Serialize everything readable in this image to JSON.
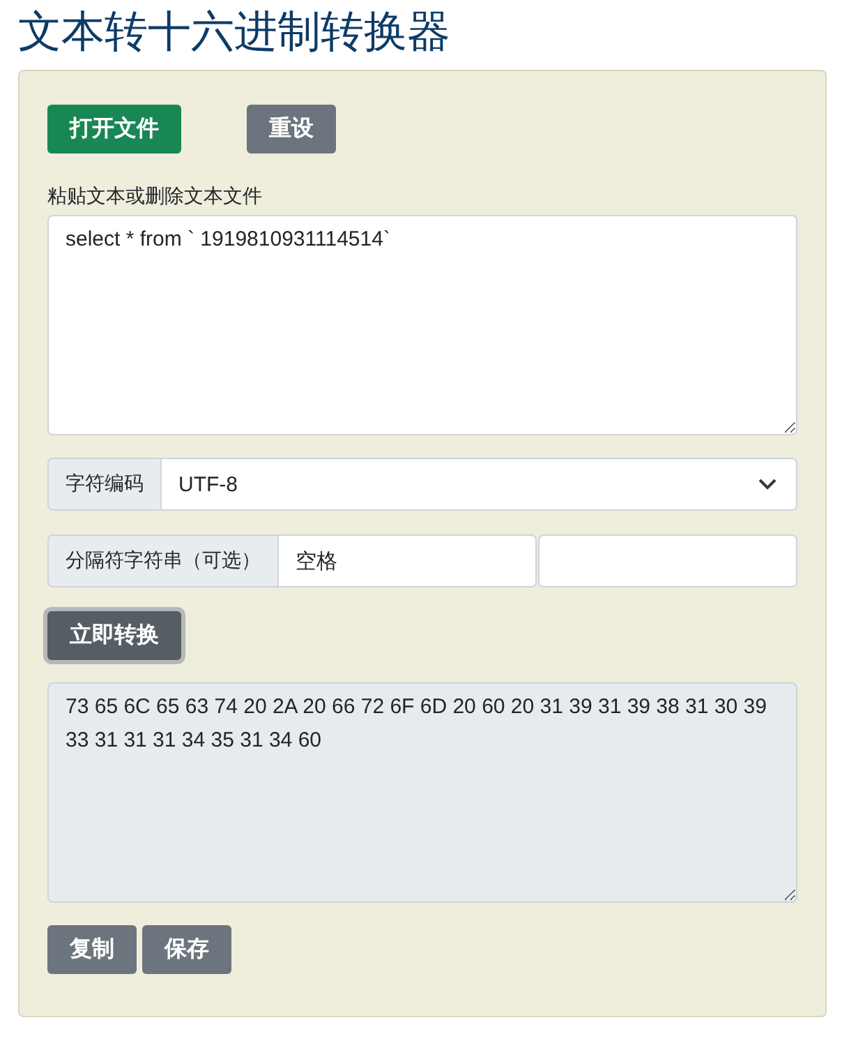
{
  "title": "文本转十六进制转换器",
  "file_buttons": [
    {
      "label": "打开文件",
      "kind": "primary"
    },
    {
      "label": "重设",
      "kind": "secondary"
    }
  ],
  "input": {
    "label": "粘贴文本或删除文本文件",
    "value": "select * from ` 1919810931114514`"
  },
  "encoding": {
    "label": "字符编码",
    "value": "UTF-8"
  },
  "separator": {
    "label": "分隔符字符串（可选）",
    "value": "空格"
  },
  "convert_button": {
    "label": "立即转换"
  },
  "output": {
    "value": "73 65 6C 65 63 74 20 2A 20 66 72 6F 6D 20 60 20 31 39 31 39 38 31 30 39 33 31 31 31 34 35 31 34 60"
  },
  "action_buttons": [
    {
      "label": "复制"
    },
    {
      "label": "保存"
    }
  ]
}
